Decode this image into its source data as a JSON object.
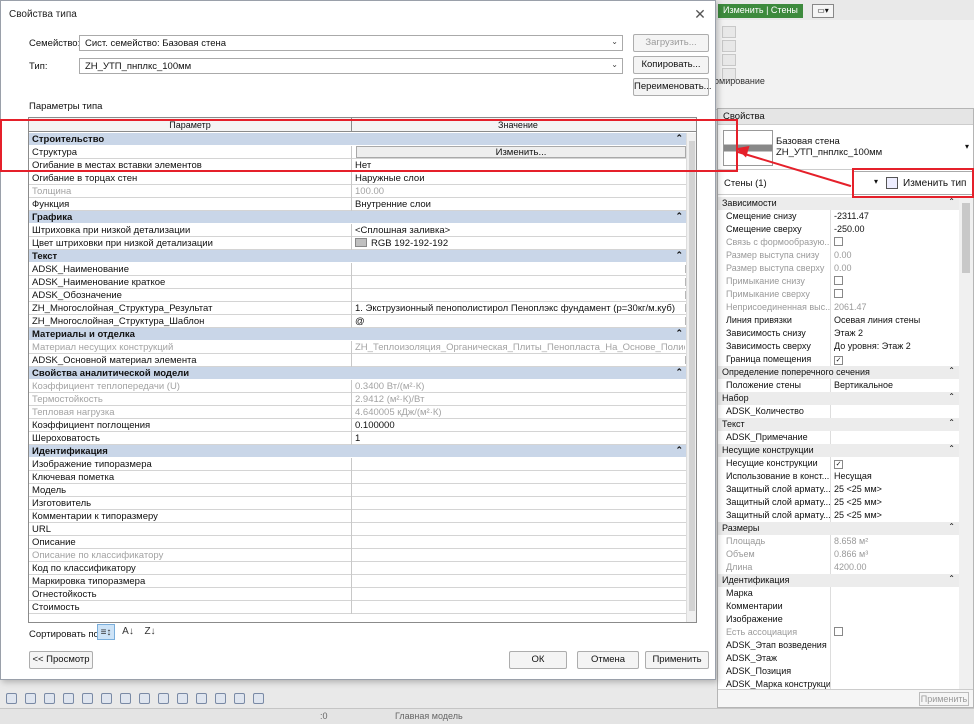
{
  "ribbon": {
    "active_tab": "Изменить | Стены",
    "group_label": "омирование"
  },
  "dialog": {
    "title": "Свойства типа",
    "family_label": "Семейство:",
    "family_value": "Сист. семейство: Базовая стена",
    "type_label": "Тип:",
    "type_value": "ZH_УТП_пнплкс_100мм",
    "load_button": "Загрузить...",
    "copy_button": "Копировать...",
    "rename_button": "Переименовать...",
    "params_title": "Параметры типа",
    "col_param": "Параметр",
    "col_value": "Значение",
    "edit_button": "Изменить...",
    "swatch_color": "#c0c0c0",
    "sections": [
      {
        "title": "Строительство",
        "rows": [
          {
            "p": "Структура",
            "v": "",
            "edit": true
          },
          {
            "p": "Огибание в местах вставки элементов",
            "v": "Нет"
          },
          {
            "p": "Огибание в торцах стен",
            "v": "Наружные слои"
          },
          {
            "p": "Толщина",
            "v": "100.00",
            "dis": true
          },
          {
            "p": "Функция",
            "v": "Внутренние слои"
          }
        ]
      },
      {
        "title": "Графика",
        "rows": [
          {
            "p": "Штриховка при низкой детализации",
            "v": "<Сплошная заливка>"
          },
          {
            "p": "Цвет штриховки при низкой детализации",
            "v": "RGB 192-192-192",
            "swatch": true
          }
        ]
      },
      {
        "title": "Текст",
        "rows": [
          {
            "p": "ADSK_Наименование",
            "v": "",
            "box": true
          },
          {
            "p": "ADSK_Наименование краткое",
            "v": "",
            "box": true
          },
          {
            "p": "ADSK_Обозначение",
            "v": "",
            "box": true
          },
          {
            "p": "ZH_Многослойная_Структура_Результат",
            "v": "1. Экструзионный пенополистирол Пеноплэкс фундамент (р=30кг/м.куб)",
            "box": true
          },
          {
            "p": "ZH_Многослойная_Структура_Шаблон",
            "v": "@",
            "box": true
          }
        ]
      },
      {
        "title": "Материалы и отделка",
        "rows": [
          {
            "p": "Материал несущих конструкций",
            "v": "ZH_Теплоизоляция_Органическая_Плиты_Пенопласта_На_Основе_Полистирола",
            "dis": true
          },
          {
            "p": "ADSK_Основной материал элемента",
            "v": "",
            "box": true
          }
        ]
      },
      {
        "title": "Свойства аналитической модели",
        "rows": [
          {
            "p": "Коэффициент теплопередачи (U)",
            "v": "0.3400 Вт/(м²·К)",
            "dis": true
          },
          {
            "p": "Термостойкость",
            "v": "2.9412 (м²·К)/Вт",
            "dis": true
          },
          {
            "p": "Тепловая нагрузка",
            "v": "4.640005 кДж/(м²·К)",
            "dis": true
          },
          {
            "p": "Коэффициент поглощения",
            "v": "0.100000"
          },
          {
            "p": "Шероховатость",
            "v": "1"
          }
        ]
      },
      {
        "title": "Идентификация",
        "rows": [
          {
            "p": "Изображение типоразмера",
            "v": ""
          },
          {
            "p": "Ключевая пометка",
            "v": ""
          },
          {
            "p": "Модель",
            "v": ""
          },
          {
            "p": "Изготовитель",
            "v": ""
          },
          {
            "p": "Комментарии к типоразмеру",
            "v": ""
          },
          {
            "p": "URL",
            "v": ""
          },
          {
            "p": "Описание",
            "v": ""
          },
          {
            "p": "Описание по классификатору",
            "v": "",
            "dis": true
          },
          {
            "p": "Код по классификатору",
            "v": ""
          },
          {
            "p": "Маркировка типоразмера",
            "v": ""
          },
          {
            "p": "Огнестойкость",
            "v": ""
          },
          {
            "p": "Стоимость",
            "v": ""
          }
        ]
      }
    ],
    "sort_label": "Сортировать по:",
    "preview_button": "<< Просмотр",
    "ok_button": "ОК",
    "cancel_button": "Отмена",
    "apply_button": "Применить"
  },
  "properties": {
    "title": "Свойства",
    "type_name_1": "Базовая стена",
    "type_name_2": "ZH_УТП_пнплкс_100мм",
    "instance_filter": "Стены (1)",
    "edit_type_button": "Изменить тип",
    "apply_button": "Применить",
    "groups": [
      {
        "title": "Зависимости",
        "rows": [
          {
            "l": "Смещение снизу",
            "v": "-2311.47"
          },
          {
            "l": "Смещение сверху",
            "v": "-250.00"
          },
          {
            "l": "Связь с формообразую...",
            "v": "",
            "chk": "",
            "dis": true
          },
          {
            "l": "Размер выступа снизу",
            "v": "0.00",
            "dis": true
          },
          {
            "l": "Размер выступа сверху",
            "v": "0.00",
            "dis": true
          },
          {
            "l": "Примыкание снизу",
            "v": "",
            "chk": "",
            "dis": true
          },
          {
            "l": "Примыкание сверху",
            "v": "",
            "chk": "",
            "dis": true
          },
          {
            "l": "Неприсоединенная выс...",
            "v": "2061.47",
            "dis": true
          },
          {
            "l": "Линия привязки",
            "v": "Осевая линия стены"
          },
          {
            "l": "Зависимость снизу",
            "v": "Этаж 2"
          },
          {
            "l": "Зависимость сверху",
            "v": "До уровня: Этаж 2"
          },
          {
            "l": "Граница помещения",
            "v": "",
            "chk": "✓"
          }
        ]
      },
      {
        "title": "Определение поперечного сечения",
        "rows": [
          {
            "l": "Положение стены",
            "v": "Вертикальное"
          }
        ]
      },
      {
        "title": "Набор",
        "rows": [
          {
            "l": "ADSK_Количество",
            "v": ""
          }
        ]
      },
      {
        "title": "Текст",
        "rows": [
          {
            "l": "ADSK_Примечание",
            "v": ""
          }
        ]
      },
      {
        "title": "Несущие конструкции",
        "rows": [
          {
            "l": "Несущие конструкции",
            "v": "",
            "chk": "✓"
          },
          {
            "l": "Использование в конст...",
            "v": "Несущая"
          },
          {
            "l": "Защитный слой армату...",
            "v": "25 <25 мм>"
          },
          {
            "l": "Защитный слой армату...",
            "v": "25 <25 мм>"
          },
          {
            "l": "Защитный слой армату...",
            "v": "25 <25 мм>"
          }
        ]
      },
      {
        "title": "Размеры",
        "rows": [
          {
            "l": "Площадь",
            "v": "8.658 м²",
            "dis": true
          },
          {
            "l": "Объем",
            "v": "0.866 м³",
            "dis": true
          },
          {
            "l": "Длина",
            "v": "4200.00",
            "dis": true
          }
        ]
      },
      {
        "title": "Идентификация",
        "rows": [
          {
            "l": "Марка",
            "v": ""
          },
          {
            "l": "Комментарии",
            "v": ""
          },
          {
            "l": "Изображение",
            "v": ""
          },
          {
            "l": "Есть ассоциация",
            "v": "",
            "chk": "",
            "dis": true
          },
          {
            "l": "ADSK_Этап возведения",
            "v": ""
          },
          {
            "l": "ADSK_Этаж",
            "v": ""
          },
          {
            "l": "ADSK_Позиция",
            "v": ""
          },
          {
            "l": "ADSK_Марка конструкции",
            "v": ""
          }
        ]
      }
    ]
  },
  "statusbar": {
    "model_label": "Главная модель",
    "select_count": ":0"
  },
  "annotation_color": "#e5202a"
}
